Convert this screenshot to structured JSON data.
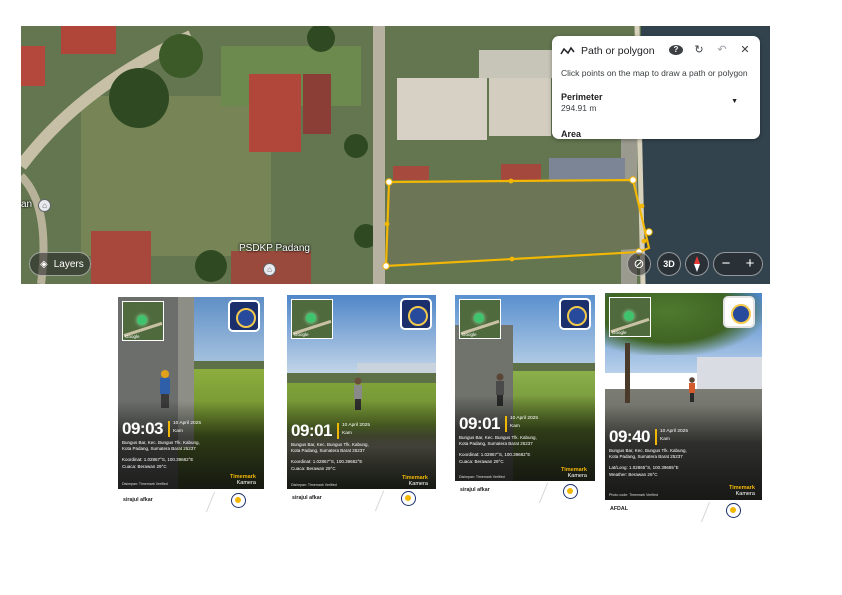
{
  "map": {
    "place_labels": [
      {
        "id": "left",
        "text": "an"
      },
      {
        "id": "psdkp",
        "text": "PSDKP Padang"
      }
    ],
    "controls": {
      "layers_label": "Layers",
      "label_3d": "3D",
      "zoom_out": "−",
      "zoom_in": "+"
    }
  },
  "path_panel": {
    "title": "Path or polygon",
    "instruction": "Click points on the map to draw a path or polygon",
    "perimeter_label": "Perimeter",
    "perimeter_value": "294.91 m",
    "area_label": "Area",
    "icons": [
      "path-icon",
      "help-icon",
      "refresh-icon",
      "undo-icon",
      "close-icon"
    ]
  },
  "photos": [
    {
      "time": "09:03",
      "date_line1": "10 April 2025",
      "date_line2": "Kam",
      "address1": "Bungus Bar, Kec. Bungus Tlk. Kabung,",
      "address2": "Kota Padang, Sumatera Barat 25237",
      "coords": "Koordinat: 1.02867°S, 100.39682°E",
      "weather": "Cuaca: Berawan 29°C",
      "brand1": "Timemark",
      "brand2": "Kamera",
      "verified": "Disimpan: Timemark Verified",
      "footer_name": "sirajul afkar"
    },
    {
      "time": "09:01",
      "date_line1": "10 April 2025",
      "date_line2": "Kam",
      "address1": "Bungus Bar, Kec. Bungus Tlk. Kabung,",
      "address2": "Kota Padang, Sumatera Barat 25237",
      "coords": "Koordinat: 1.02867°S, 100.39682°E",
      "weather": "Cuaca: Berawan 29°C",
      "brand1": "Timemark",
      "brand2": "Kamera",
      "verified": "Disimpan: Timemark Verified",
      "footer_name": "sirajul afkar"
    },
    {
      "time": "09:01",
      "date_line1": "10 April 2025",
      "date_line2": "Kam",
      "address1": "Bungus Bar, Kec. Bungus Tlk. Kabung,",
      "address2": "Kota Padang, Sumatera Barat 25237",
      "coords": "Koordinat: 1.02867°S, 100.39682°E",
      "weather": "Cuaca: Berawan 29°C",
      "brand1": "Timemark",
      "brand2": "Kamera",
      "verified": "Disimpan: Timemark Verified",
      "footer_name": "sirajul afkar"
    },
    {
      "time": "09:40",
      "date_line1": "10 April 2025",
      "date_line2": "Kam",
      "address1": "Bungus Bar, Kec. Bungus Tlk. Kabung,",
      "address2": "Kota Padang, Sumatera Barat 25237",
      "coords": "Lat/Long: 1.02865°S, 100.39685°E",
      "weather": "Weather: Berawan 26°C",
      "brand1": "Timemark",
      "brand2": "Kamera",
      "verified": "Photo code: Timemark Verified",
      "footer_name": "AFDAL"
    }
  ],
  "colors": {
    "polygon": "#f2b705",
    "panel_text": "#202124",
    "timestamp_accent": "#f2b705"
  }
}
